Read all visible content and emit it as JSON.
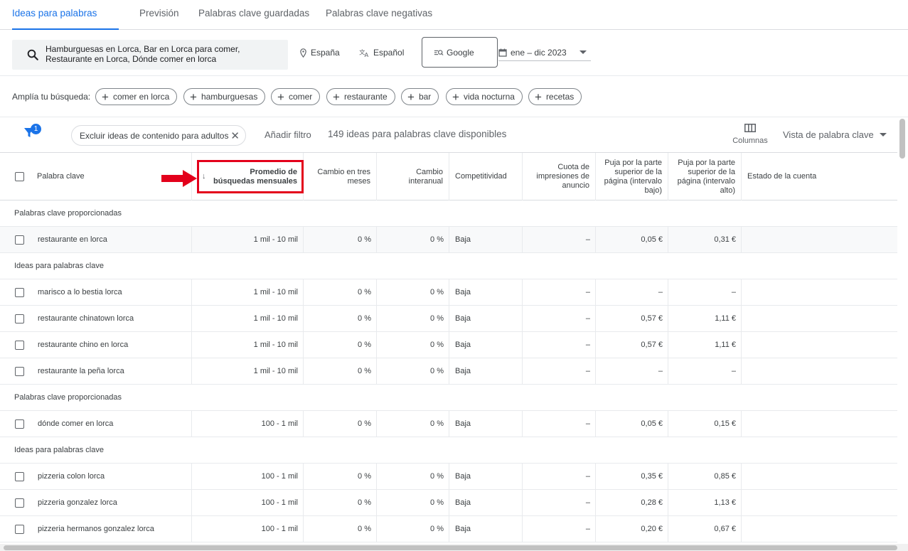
{
  "tabs": [
    {
      "label": "Ideas para palabras clave",
      "active": true
    },
    {
      "label": "Previsión",
      "active": false
    },
    {
      "label": "Palabras clave guardadas",
      "active": false
    },
    {
      "label": "Palabras clave negativas",
      "active": false
    }
  ],
  "search": {
    "text": "Hamburguesas en Lorca, Bar en Lorca para comer, Restaurante en Lorca, Dónde comer en lorca",
    "location": "España",
    "language": "Español",
    "engine": "Google",
    "date_range": "ene – dic 2023"
  },
  "expand": {
    "label": "Amplía tu búsqueda:",
    "chips": [
      "comer en lorca",
      "hamburguesas",
      "comer",
      "restaurante",
      "bar",
      "vida nocturna",
      "recetas"
    ]
  },
  "toolbar": {
    "filter_count": "1",
    "exclude_chip": "Excluir ideas de contenido para adultos",
    "add_filter": "Añadir filtro",
    "ideas_count": "149 ideas para palabras clave disponibles",
    "columns_label": "Columnas",
    "view_label": "Vista de palabra clave"
  },
  "columns": {
    "keyword": "Palabra clave",
    "avg_searches": "Promedio de búsquedas mensuales",
    "three_month": "Cambio en tres meses",
    "yoy": "Cambio interanual",
    "competition": "Competitividad",
    "impr_share": "Cuota de impresiones de anuncio",
    "bid_low": "Puja por la parte superior de la página (intervalo bajo)",
    "bid_high": "Puja por la parte superior de la página (intervalo alto)",
    "account_status": "Estado de la cuenta"
  },
  "sections": [
    {
      "title": "Palabras clave proporcionadas",
      "rows": [
        {
          "keyword": "restaurante en lorca",
          "avg": "1 mil - 10 mil",
          "three": "0 %",
          "yoy": "0 %",
          "comp": "Baja",
          "share": "–",
          "low": "0,05 €",
          "high": "0,31 €"
        }
      ]
    },
    {
      "title": "Ideas para palabras clave",
      "rows": [
        {
          "keyword": "marisco a lo bestia lorca",
          "avg": "1 mil - 10 mil",
          "three": "0 %",
          "yoy": "0 %",
          "comp": "Baja",
          "share": "–",
          "low": "–",
          "high": "–"
        },
        {
          "keyword": "restaurante chinatown lorca",
          "avg": "1 mil - 10 mil",
          "three": "0 %",
          "yoy": "0 %",
          "comp": "Baja",
          "share": "–",
          "low": "0,57 €",
          "high": "1,11 €"
        },
        {
          "keyword": "restaurante chino en lorca",
          "avg": "1 mil - 10 mil",
          "three": "0 %",
          "yoy": "0 %",
          "comp": "Baja",
          "share": "–",
          "low": "0,57 €",
          "high": "1,11 €"
        },
        {
          "keyword": "restaurante la peña lorca",
          "avg": "1 mil - 10 mil",
          "three": "0 %",
          "yoy": "0 %",
          "comp": "Baja",
          "share": "–",
          "low": "–",
          "high": "–"
        }
      ]
    },
    {
      "title": "Palabras clave proporcionadas",
      "rows": [
        {
          "keyword": "dónde comer en lorca",
          "avg": "100 - 1 mil",
          "three": "0 %",
          "yoy": "0 %",
          "comp": "Baja",
          "share": "–",
          "low": "0,05 €",
          "high": "0,15 €"
        }
      ]
    },
    {
      "title": "Ideas para palabras clave",
      "rows": [
        {
          "keyword": "pizzeria colon lorca",
          "avg": "100 - 1 mil",
          "three": "0 %",
          "yoy": "0 %",
          "comp": "Baja",
          "share": "–",
          "low": "0,35 €",
          "high": "0,85 €"
        },
        {
          "keyword": "pizzeria gonzalez lorca",
          "avg": "100 - 1 mil",
          "three": "0 %",
          "yoy": "0 %",
          "comp": "Baja",
          "share": "–",
          "low": "0,28 €",
          "high": "1,13 €"
        },
        {
          "keyword": "pizzeria hermanos gonzalez lorca",
          "avg": "100 - 1 mil",
          "three": "0 %",
          "yoy": "0 %",
          "comp": "Baja",
          "share": "–",
          "low": "0,20 €",
          "high": "0,67 €"
        }
      ]
    }
  ],
  "colors": {
    "accent": "#1a73e8",
    "highlight": "#e3001b"
  }
}
